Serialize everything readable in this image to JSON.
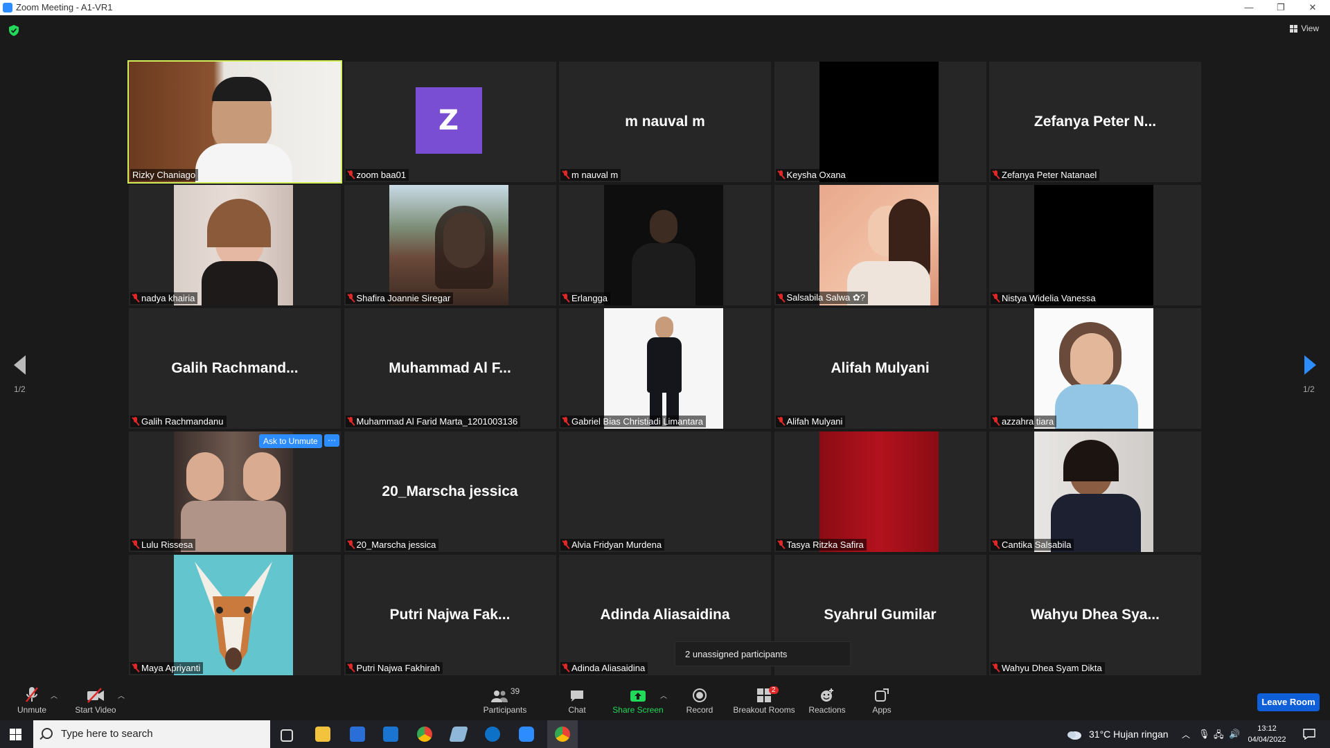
{
  "window": {
    "title": "Zoom Meeting - A1-VR1"
  },
  "top": {
    "view_label": "View"
  },
  "tiles": [
    {
      "name": "Rizky Chaniago",
      "display": "",
      "muted": false,
      "kind": "video",
      "active": true
    },
    {
      "name": "zoom baa01",
      "display": "",
      "muted": true,
      "kind": "avatar",
      "avatar_letter": "Z"
    },
    {
      "name": "m nauval m",
      "display": "m nauval m",
      "muted": true,
      "kind": "text"
    },
    {
      "name": "Keysha Oxana",
      "display": "",
      "muted": true,
      "kind": "black"
    },
    {
      "name": "Zefanya Peter Natanael",
      "display": "Zefanya Peter N...",
      "muted": true,
      "kind": "text"
    },
    {
      "name": "nadya khairia",
      "display": "",
      "muted": true,
      "kind": "video"
    },
    {
      "name": "Shafira Joannie Siregar",
      "display": "",
      "muted": true,
      "kind": "video"
    },
    {
      "name": "Erlangga",
      "display": "",
      "muted": true,
      "kind": "video"
    },
    {
      "name": "Salsabila Salwa ✿?",
      "display": "",
      "muted": true,
      "kind": "video"
    },
    {
      "name": "Nistya Widelia Vanessa",
      "display": "",
      "muted": true,
      "kind": "black"
    },
    {
      "name": "Galih Rachmandanu",
      "display": "Galih  Rachmand...",
      "muted": true,
      "kind": "text"
    },
    {
      "name": "Muhammad Al Farid Marta_1201003136",
      "display": "Muhammad  Al  F...",
      "muted": true,
      "kind": "text"
    },
    {
      "name": "Gabriel Bias Christiadi Limantara",
      "display": "",
      "muted": true,
      "kind": "video"
    },
    {
      "name": "Alifah Mulyani",
      "display": "Alifah Mulyani",
      "muted": true,
      "kind": "text"
    },
    {
      "name": "azzahra tiara",
      "display": "",
      "muted": true,
      "kind": "video"
    },
    {
      "name": "Lulu Rissesa",
      "display": "",
      "muted": true,
      "kind": "video"
    },
    {
      "name": "20_Marscha jessica",
      "display": "20_Marscha jessica",
      "muted": true,
      "kind": "text"
    },
    {
      "name": "Alvia Fridyan Murdena",
      "display": "",
      "muted": true,
      "kind": "empty"
    },
    {
      "name": "Tasya Ritzka Safira",
      "display": "",
      "muted": true,
      "kind": "red"
    },
    {
      "name": "Cantika Salsabila",
      "display": "",
      "muted": true,
      "kind": "video"
    },
    {
      "name": "Maya Apriyanti",
      "display": "",
      "muted": true,
      "kind": "giraffe"
    },
    {
      "name": "Putri Najwa Fakhirah",
      "display": "Putri  Najwa  Fak...",
      "muted": true,
      "kind": "text"
    },
    {
      "name": "Adinda Aliasaidina",
      "display": "Adinda Aliasaidina",
      "muted": true,
      "kind": "text"
    },
    {
      "name": "",
      "display": "Syahrul Gumilar",
      "muted": false,
      "kind": "text"
    },
    {
      "name": "Wahyu Dhea Syam Dikta",
      "display": "Wahyu  Dhea  Sya...",
      "muted": true,
      "kind": "text"
    }
  ],
  "ask_to_unmute": "Ask to Unmute",
  "more_label": "···",
  "pagination": {
    "left": "1/2",
    "right": "1/2"
  },
  "tooltip": "2 unassigned participants",
  "toolbar": {
    "unmute": "Unmute",
    "start_video": "Start Video",
    "participants": "Participants",
    "participants_count": "39",
    "chat": "Chat",
    "share_screen": "Share Screen",
    "record": "Record",
    "breakout_rooms": "Breakout Rooms",
    "breakout_badge": "2",
    "reactions": "Reactions",
    "apps": "Apps",
    "leave": "Leave Room"
  },
  "taskbar": {
    "search_placeholder": "Type here to search",
    "weather": "31°C  Hujan ringan",
    "time": "13:12",
    "date": "04/04/2022"
  },
  "colors": {
    "accent_blue": "#2d8cff",
    "active_speaker": "#d2f05c",
    "muted_red": "#e02828",
    "green": "#23d959"
  }
}
